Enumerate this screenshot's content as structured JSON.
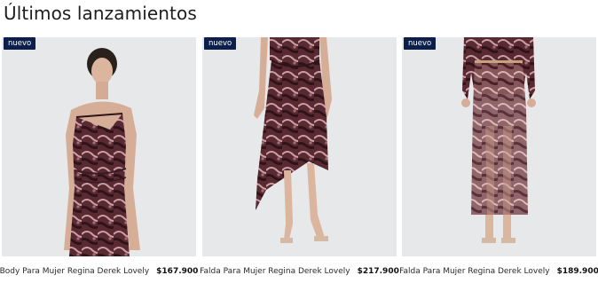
{
  "section": {
    "title": "Últimos lanzamientos"
  },
  "products": [
    {
      "badge": "nuevo",
      "name": "Body Para Mujer Regina Derek Lovely",
      "price": "$167.900",
      "image": "model wearing one-shoulder animal print mesh body"
    },
    {
      "badge": "nuevo",
      "name": "Falda Para Mujer Regina Derek Lovely",
      "price": "$217.900",
      "image": "model wearing asymmetric animal print mesh skirt"
    },
    {
      "badge": "nuevo",
      "name": "Falda Para Mujer Regina Derek Lovely",
      "price": "$189.900",
      "image": "model wearing long sheer animal print mesh skirt"
    }
  ],
  "colors": {
    "badge_bg": "#0c1f4a",
    "image_bg": "#e7e8ea",
    "print_dark": "#3a1c22",
    "print_mid": "#7a3d45",
    "print_light": "#c9a0a4",
    "skin": "#d8b09a"
  }
}
